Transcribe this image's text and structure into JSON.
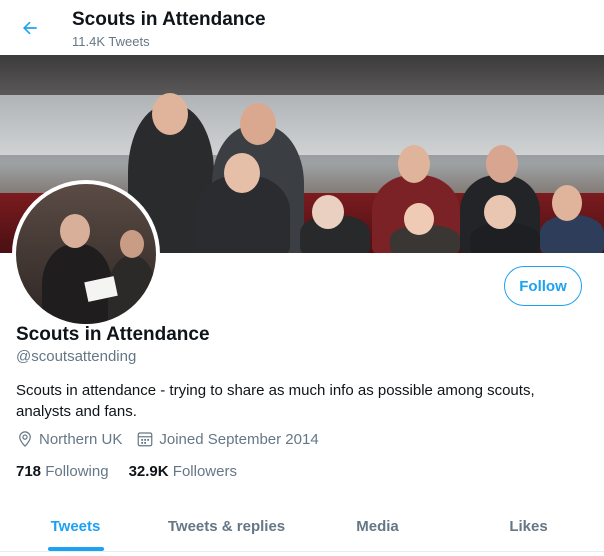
{
  "header": {
    "title": "Scouts in Attendance",
    "tweet_count": "11.4K Tweets"
  },
  "profile": {
    "name": "Scouts in Attendance",
    "handle": "@scoutsattending",
    "bio": "Scouts in attendance - trying to share as much info as possible among scouts, analysts and fans.",
    "location": "Northern UK",
    "joined": "Joined September 2014",
    "following_count": "718",
    "following_label": "Following",
    "followers_count": "32.9K",
    "followers_label": "Followers",
    "follow_button": "Follow"
  },
  "tabs": [
    {
      "label": "Tweets",
      "active": true
    },
    {
      "label": "Tweets & replies",
      "active": false
    },
    {
      "label": "Media",
      "active": false
    },
    {
      "label": "Likes",
      "active": false
    }
  ],
  "colors": {
    "accent": "#1da1f2",
    "muted": "#657786",
    "text": "#0f1419"
  },
  "icons": {
    "back": "arrow-left-icon",
    "location": "location-pin-icon",
    "joined": "calendar-icon"
  }
}
